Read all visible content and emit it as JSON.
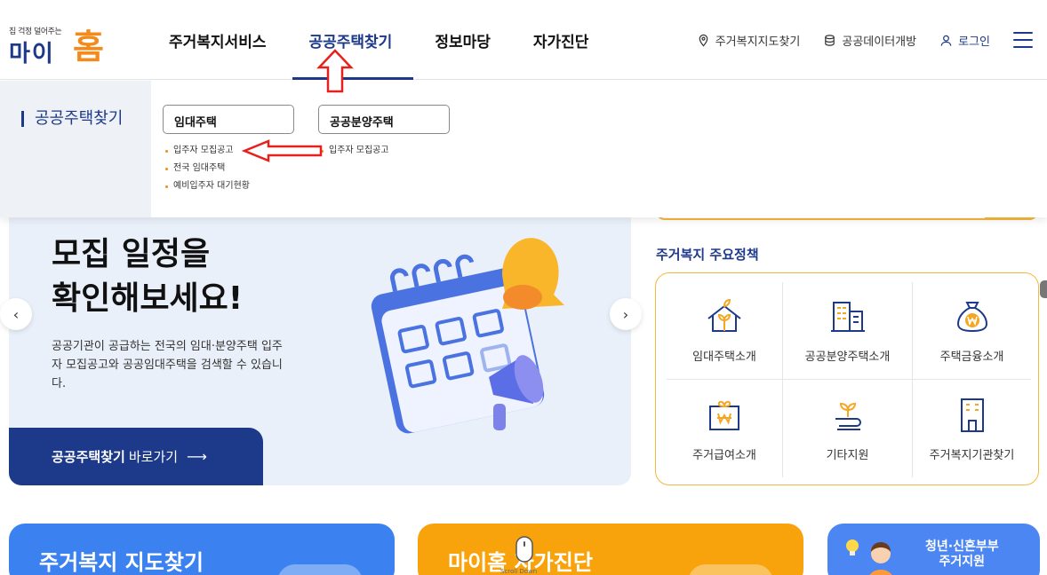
{
  "header": {
    "logo_tagline": "집 걱정 덜어주는",
    "logo_main": "마이",
    "logo_home": "홈",
    "nav": [
      {
        "label": "주거복지서비스"
      },
      {
        "label": "공공주택찾기"
      },
      {
        "label": "정보마당"
      },
      {
        "label": "자가진단"
      }
    ],
    "util": {
      "map": "주거복지지도찾기",
      "open_data": "공공데이터개방",
      "login": "로그인"
    }
  },
  "dropdown": {
    "section_title": "공공주택찾기",
    "rental": {
      "heading": "임대주택",
      "links": [
        "입주자 모집공고",
        "전국 임대주택",
        "예비입주자 대기현황"
      ]
    },
    "sale": {
      "heading": "공공분양주택",
      "links": [
        "입주자 모집공고"
      ]
    }
  },
  "hero": {
    "title_line1": "모집 일정을",
    "title_line2": "확인해보세요!",
    "desc": "공공기관이 공급하는 전국의 임대·분양주택 입주자 모집공고와 공공임대주택을 검색할 수 있습니다.",
    "cta_bold": "공공주택찾기",
    "cta_rest": "바로가기",
    "cta_arrow": "⟶",
    "prev": "‹",
    "next": "›"
  },
  "policy": {
    "title": "주거복지 주요정책",
    "items": [
      {
        "label": "임대주택소개",
        "icon": "house-sprout-icon"
      },
      {
        "label": "공공분양주택소개",
        "icon": "building-icon"
      },
      {
        "label": "주택금융소개",
        "icon": "money-bag-icon"
      },
      {
        "label": "주거급여소개",
        "icon": "gift-won-icon"
      },
      {
        "label": "기타지원",
        "icon": "sprout-icon"
      },
      {
        "label": "주거복지기관찾기",
        "icon": "office-building-icon"
      }
    ]
  },
  "cards": {
    "map": "주거복지 지도찾기",
    "selfcheck": "마이홈 자가진단",
    "youth_line1": "청년·신혼부부",
    "youth_line2": "주거지원",
    "scroll_down": "Scroll Down"
  },
  "colors": {
    "primary": "#1d3a8a",
    "accent": "#f48a1a",
    "policy_border": "#f5b83a",
    "annotation_red": "#e8201c"
  }
}
